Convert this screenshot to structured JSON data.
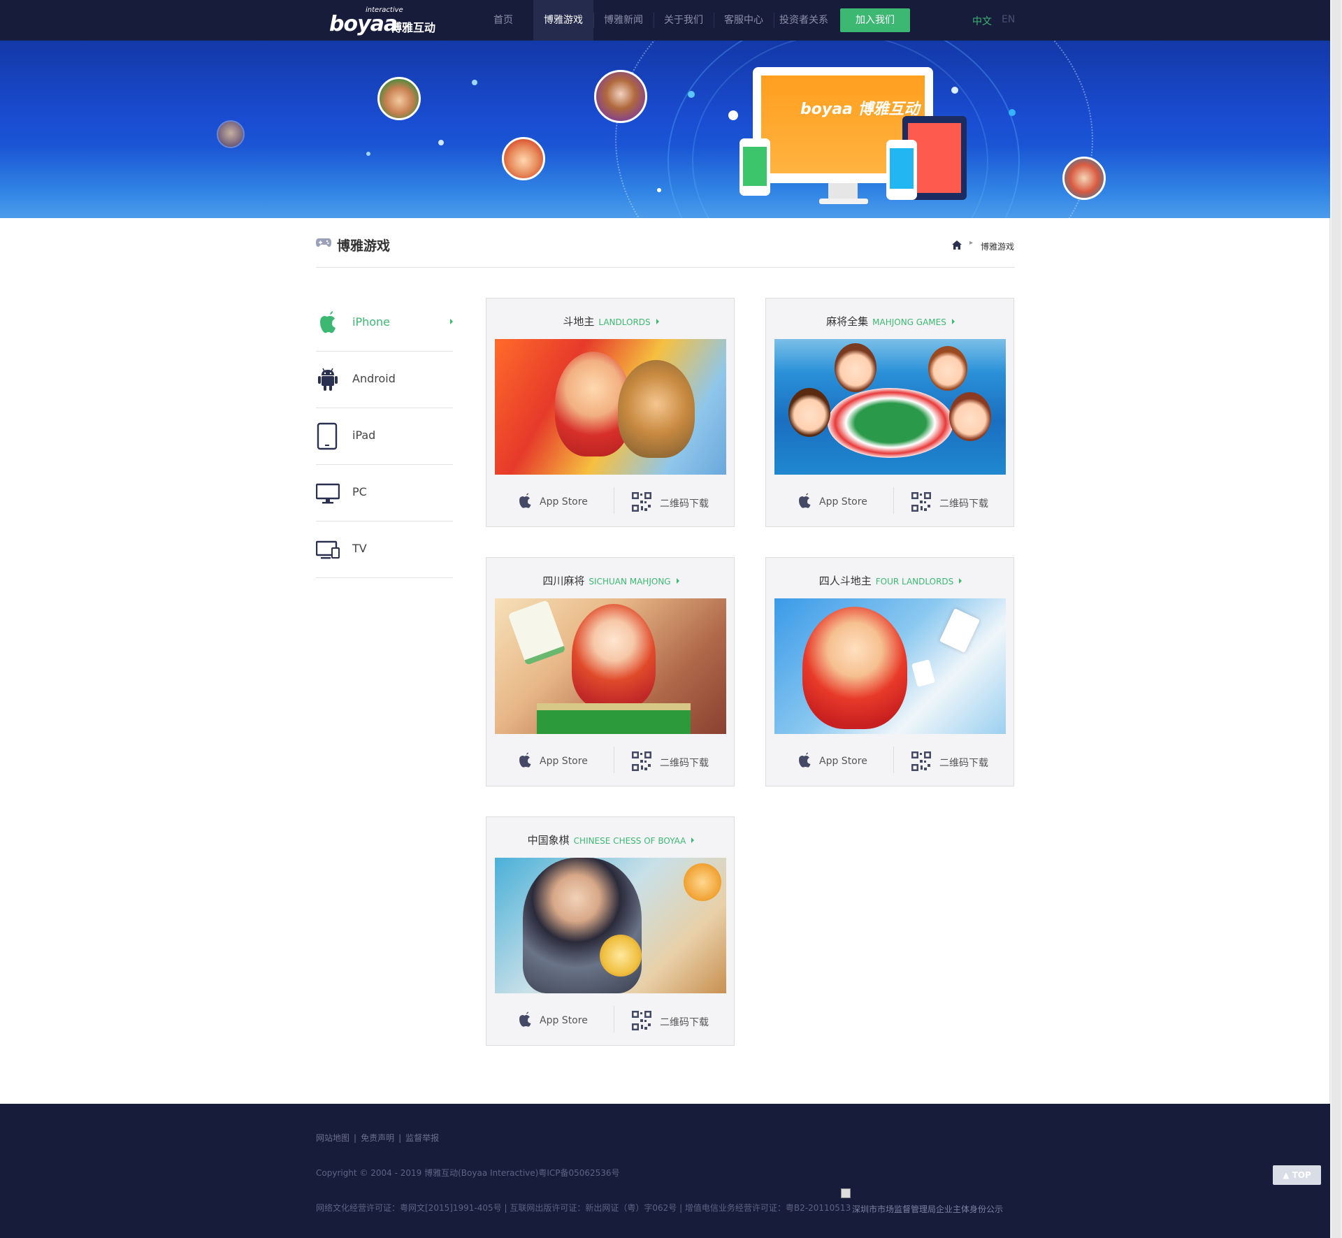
{
  "header": {
    "logo_small": "interactive",
    "logo_word": "boyaa",
    "logo_cn": "博雅互动",
    "nav": [
      {
        "label": "首页",
        "active": false
      },
      {
        "label": "博雅游戏",
        "active": true
      },
      {
        "label": "博雅新闻",
        "active": false
      },
      {
        "label": "关于我们",
        "active": false
      },
      {
        "label": "客服中心",
        "active": false
      },
      {
        "label": "投资者关系",
        "active": false
      }
    ],
    "join_label": "加入我们",
    "lang_cn": "中文",
    "lang_en": "EN"
  },
  "banner": {
    "monitor_brand": "boyaa 博雅互动"
  },
  "page": {
    "title": "博雅游戏",
    "breadcrumb_current": "博雅游戏",
    "home_icon": "home-icon",
    "title_icon": "gamepad-icon"
  },
  "platforms": [
    {
      "label": "iPhone",
      "icon": "apple-icon",
      "active": true
    },
    {
      "label": "Android",
      "icon": "android-icon",
      "active": false
    },
    {
      "label": "iPad",
      "icon": "tablet-icon",
      "active": false
    },
    {
      "label": "PC",
      "icon": "monitor-icon",
      "active": false
    },
    {
      "label": "TV",
      "icon": "tv-icon",
      "active": false
    }
  ],
  "games": [
    {
      "name_cn": "斗地主",
      "name_en": "LANDLORDS",
      "appstore": "App Store",
      "qr": "二维码下载"
    },
    {
      "name_cn": "麻将全集",
      "name_en": "MAHJONG GAMES",
      "appstore": "App Store",
      "qr": "二维码下载"
    },
    {
      "name_cn": "四川麻将",
      "name_en": "SICHUAN MAHJONG",
      "appstore": "App Store",
      "qr": "二维码下载"
    },
    {
      "name_cn": "四人斗地主",
      "name_en": "FOUR LANDLORDS",
      "appstore": "App Store",
      "qr": "二维码下载"
    },
    {
      "name_cn": "中国象棋",
      "name_en": "CHINESE CHESS OF BOYAA",
      "appstore": "App Store",
      "qr": "二维码下载"
    }
  ],
  "footer": {
    "links": [
      "网站地图",
      "免责声明",
      "监督举报"
    ],
    "link_separator": "|",
    "copyright": "Copyright © 2004 - 2019 博雅互动(Boyaa Interactive)粤ICP备05062536号",
    "license": "网络文化经营许可证：粤网文[2015]1991-405号 | 互联网出版许可证：新出网证（粤）字062号 | 增值电信业务经营许可证：粤B2-20110513",
    "gov_link": "深圳市市场监督管理局企业主体身份公示",
    "top_label": "TOP"
  },
  "colors": {
    "nav_bg": "#171c3a",
    "accent_green": "#3cb873",
    "card_bg": "#f4f4f6",
    "footer_bg": "#171c3a"
  }
}
